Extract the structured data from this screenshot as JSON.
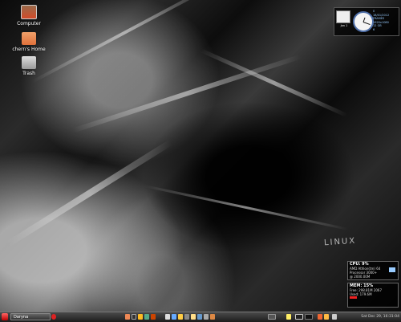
{
  "desktop": {
    "icons": [
      {
        "label": "Computer"
      },
      {
        "label": "chern's Home"
      },
      {
        "label": "Trash"
      }
    ]
  },
  "watermark": "LINUX",
  "clock_widget": {
    "date": "Jan 1",
    "lines": [
      "0",
      "18/01/2012",
      "FRAMES",
      "1920x1080",
      "12 GB",
      "6"
    ]
  },
  "cpu_widget": {
    "title": "CPU: 9%",
    "lines": [
      "AMD Athlon(tm) 64",
      "Processor 3000+",
      "@ 2000.00M"
    ]
  },
  "mem_widget": {
    "title": "MEM: 15%",
    "lines": [
      "Free: 298.81M 2067",
      "Used: 179.6M"
    ]
  },
  "taskbar": {
    "window_task": "Daryna",
    "clock": "Sat Dec 29, 16:31:04"
  },
  "colors": {
    "taskbar": "#2a2a2a",
    "accent": "#4f6fa8"
  }
}
